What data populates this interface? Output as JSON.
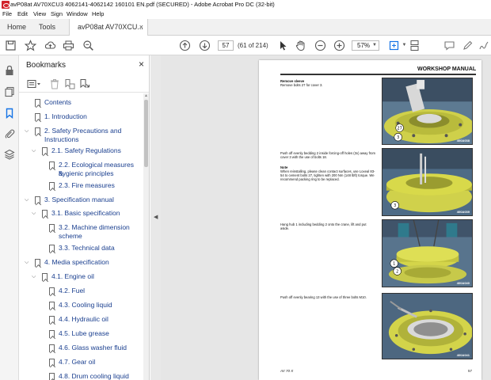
{
  "window": {
    "title": "avP08at AV70XCU3 4062141-4062142 160101 EN.pdf (SECURED) - Adobe Acrobat Pro DC (32-bit)"
  },
  "menu": [
    "File",
    "Edit",
    "View",
    "Sign",
    "Window",
    "Help"
  ],
  "tabs": {
    "home": "Home",
    "tools": "Tools",
    "document": "avP08at AV70XCU...",
    "close": "×"
  },
  "toolbar": {
    "page_number": "57",
    "page_count": "(61 of 214)",
    "zoom": "57%"
  },
  "bookmarks": {
    "title": "Bookmarks",
    "close": "×",
    "items": [
      {
        "label": "Contents"
      },
      {
        "label": "1. Introduction"
      },
      {
        "label": "2. Safety Precautions and"
      },
      {
        "label": "Instructions"
      },
      {
        "label": "2.1. Safety Regulations"
      },
      {
        "label": "2.2. Ecological measures &"
      },
      {
        "label": "hygienic principles"
      },
      {
        "label": "2.3. Fire measures"
      },
      {
        "label": "3. Specification manual"
      },
      {
        "label": "3.1. Basic specification"
      },
      {
        "label": "3.2. Machine dimension"
      },
      {
        "label": "scheme"
      },
      {
        "label": "3.3. Technical data"
      },
      {
        "label": "4. Media specification"
      },
      {
        "label": "4.1. Engine oil"
      },
      {
        "label": "4.2. Fuel"
      },
      {
        "label": "4.3. Cooling liquid"
      },
      {
        "label": "4.4. Hydraulic oil"
      },
      {
        "label": "4.5. Lube grease"
      },
      {
        "label": "4.6. Glass washer fluid"
      },
      {
        "label": "4.7. Gear oil"
      },
      {
        "label": "4.8. Drum cooling liquid"
      }
    ]
  },
  "page": {
    "header": "WORKSHOP MANUAL",
    "step1_title": "Remove sleeve",
    "step1_text": "Remove bolts 27 for cover 3.",
    "step2_text": "Push off evenly bedding 2 inside forcing-off holes (3x) away from cover 3 with the use of bolts 18.",
    "note_title": "Note",
    "note_text": "When reinstalling, please clean contact surfaces, use Loxeal 83-54 to cement bolts 27, tighten with 200 Nm (148 lbft) torque. We recommend packing ring to be replaced.",
    "step3_text": "Hang hub 1 including bedding 2 onto the crane, lift and put aside.",
    "step4_text": "Push off evenly bearing 13 with the use of three bolts M10.",
    "footer_left": "AV 70 X",
    "footer_right": "57",
    "photo_codes": [
      "400A038",
      "400A039",
      "400A040",
      "400A041"
    ],
    "photo1_callouts": [
      "27",
      "3"
    ],
    "photo2_callouts": [
      "3"
    ],
    "photo3_callouts": [
      "1",
      "2"
    ]
  },
  "colors": {
    "accent": "#1473e6",
    "bookmark_text": "#1a3f8f",
    "machine_yellow": "#d8d94a"
  }
}
